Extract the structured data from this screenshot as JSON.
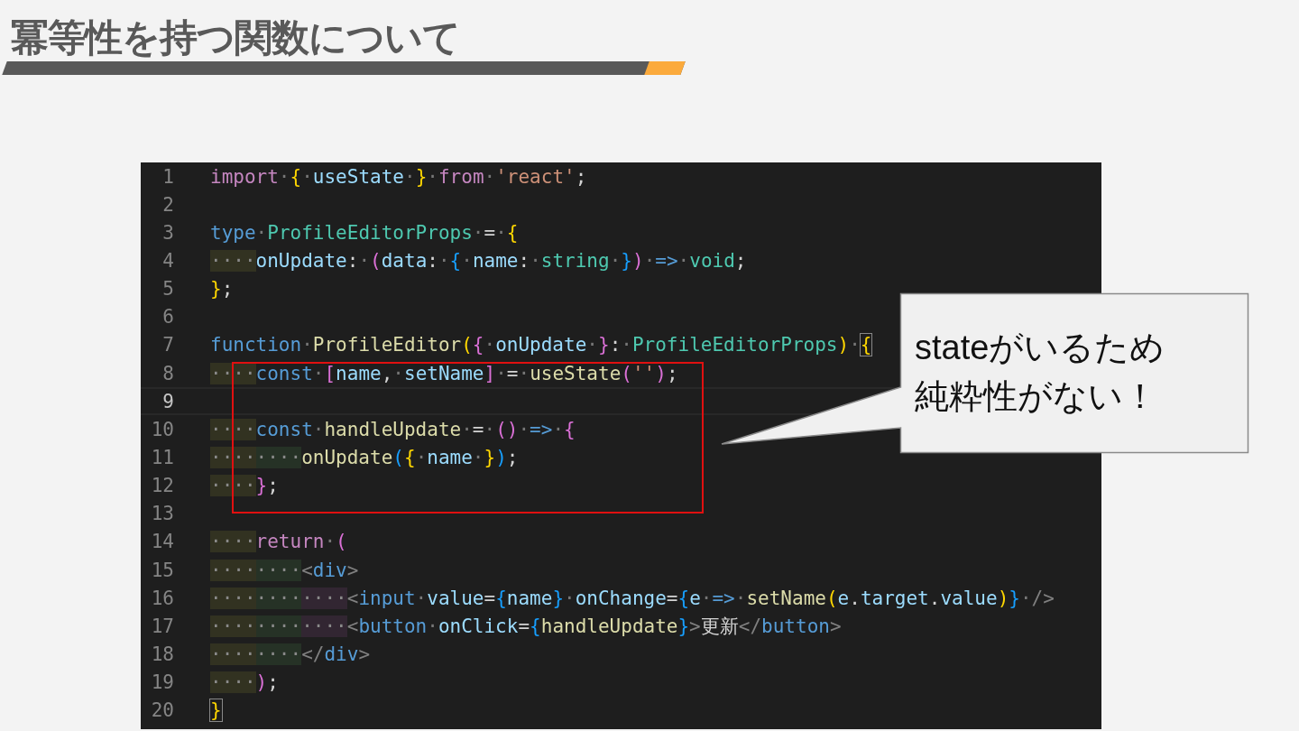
{
  "slide": {
    "title": "冪等性を持つ関数について"
  },
  "editor": {
    "lines": [
      {
        "n": "1",
        "current": false,
        "t": [
          {
            "s": "import",
            "kind": "kw"
          },
          {
            "s": "·",
            "kind": "ws"
          },
          {
            "s": "{",
            "kind": "b1"
          },
          {
            "s": "·",
            "kind": "ws"
          },
          {
            "s": "useState",
            "kind": "var"
          },
          {
            "s": "·",
            "kind": "ws"
          },
          {
            "s": "}",
            "kind": "b1"
          },
          {
            "s": "·",
            "kind": "ws"
          },
          {
            "s": "from",
            "kind": "kw"
          },
          {
            "s": "·",
            "kind": "ws"
          },
          {
            "s": "'react'",
            "kind": "str"
          },
          {
            "s": ";",
            "kind": "p"
          }
        ]
      },
      {
        "n": "2",
        "current": false
      },
      {
        "n": "3",
        "current": false,
        "t": [
          {
            "s": "type",
            "kind": "st"
          },
          {
            "s": "·",
            "kind": "ws"
          },
          {
            "s": "ProfileEditorProps",
            "kind": "ty"
          },
          {
            "s": "·",
            "kind": "ws"
          },
          {
            "s": "=",
            "kind": "p"
          },
          {
            "s": "·",
            "kind": "ws"
          },
          {
            "s": "{",
            "kind": "b1"
          }
        ]
      },
      {
        "n": "4",
        "current": false,
        "t": [
          {
            "s": "····",
            "kind": "ind"
          },
          {
            "s": "onUpdate",
            "kind": "var"
          },
          {
            "s": ":",
            "kind": "p"
          },
          {
            "s": "·",
            "kind": "ws"
          },
          {
            "s": "(",
            "kind": "b2"
          },
          {
            "s": "data",
            "kind": "var"
          },
          {
            "s": ":",
            "kind": "p"
          },
          {
            "s": "·",
            "kind": "ws"
          },
          {
            "s": "{",
            "kind": "b3"
          },
          {
            "s": "·",
            "kind": "ws"
          },
          {
            "s": "name",
            "kind": "var"
          },
          {
            "s": ":",
            "kind": "p"
          },
          {
            "s": "·",
            "kind": "ws"
          },
          {
            "s": "string",
            "kind": "ty"
          },
          {
            "s": "·",
            "kind": "ws"
          },
          {
            "s": "}",
            "kind": "b3"
          },
          {
            "s": ")",
            "kind": "b2"
          },
          {
            "s": "·",
            "kind": "ws"
          },
          {
            "s": "=>",
            "kind": "st"
          },
          {
            "s": "·",
            "kind": "ws"
          },
          {
            "s": "void",
            "kind": "ty"
          },
          {
            "s": ";",
            "kind": "p"
          }
        ]
      },
      {
        "n": "5",
        "current": false,
        "t": [
          {
            "s": "}",
            "kind": "b1"
          },
          {
            "s": ";",
            "kind": "p"
          }
        ]
      },
      {
        "n": "6",
        "current": false
      },
      {
        "n": "7",
        "current": false,
        "t": [
          {
            "s": "function",
            "kind": "st"
          },
          {
            "s": "·",
            "kind": "ws"
          },
          {
            "s": "ProfileEditor",
            "kind": "fn"
          },
          {
            "s": "(",
            "kind": "b1"
          },
          {
            "s": "{",
            "kind": "b2"
          },
          {
            "s": "·",
            "kind": "ws"
          },
          {
            "s": "onUpdate",
            "kind": "var"
          },
          {
            "s": "·",
            "kind": "ws"
          },
          {
            "s": "}",
            "kind": "b2"
          },
          {
            "s": ":",
            "kind": "p"
          },
          {
            "s": "·",
            "kind": "ws"
          },
          {
            "s": "ProfileEditorProps",
            "kind": "ty"
          },
          {
            "s": ")",
            "kind": "b1"
          },
          {
            "s": "·",
            "kind": "ws"
          },
          {
            "s": "{",
            "kind": "b1",
            "match": true
          }
        ]
      },
      {
        "n": "8",
        "current": false,
        "t": [
          {
            "s": "····",
            "kind": "ind"
          },
          {
            "s": "const",
            "kind": "st"
          },
          {
            "s": "·",
            "kind": "ws"
          },
          {
            "s": "[",
            "kind": "b2"
          },
          {
            "s": "name",
            "kind": "var"
          },
          {
            "s": ",",
            "kind": "p"
          },
          {
            "s": "·",
            "kind": "ws"
          },
          {
            "s": "setName",
            "kind": "var"
          },
          {
            "s": "]",
            "kind": "b2"
          },
          {
            "s": "·",
            "kind": "ws"
          },
          {
            "s": "=",
            "kind": "p"
          },
          {
            "s": "·",
            "kind": "ws"
          },
          {
            "s": "useState",
            "kind": "fn"
          },
          {
            "s": "(",
            "kind": "b2"
          },
          {
            "s": "''",
            "kind": "str"
          },
          {
            "s": ")",
            "kind": "b2"
          },
          {
            "s": ";",
            "kind": "p"
          }
        ]
      },
      {
        "n": "9",
        "current": true
      },
      {
        "n": "10",
        "current": false,
        "t": [
          {
            "s": "····",
            "kind": "ind"
          },
          {
            "s": "const",
            "kind": "st"
          },
          {
            "s": "·",
            "kind": "ws"
          },
          {
            "s": "handleUpdate",
            "kind": "fn"
          },
          {
            "s": "·",
            "kind": "ws"
          },
          {
            "s": "=",
            "kind": "p"
          },
          {
            "s": "·",
            "kind": "ws"
          },
          {
            "s": "(",
            "kind": "b2"
          },
          {
            "s": ")",
            "kind": "b2"
          },
          {
            "s": "·",
            "kind": "ws"
          },
          {
            "s": "=>",
            "kind": "st"
          },
          {
            "s": "·",
            "kind": "ws"
          },
          {
            "s": "{",
            "kind": "b2"
          }
        ]
      },
      {
        "n": "11",
        "current": false,
        "t": [
          {
            "s": "········",
            "kind": "ind"
          },
          {
            "s": "onUpdate",
            "kind": "fn"
          },
          {
            "s": "(",
            "kind": "b3"
          },
          {
            "s": "{",
            "kind": "b1"
          },
          {
            "s": "·",
            "kind": "ws"
          },
          {
            "s": "name",
            "kind": "var"
          },
          {
            "s": "·",
            "kind": "ws"
          },
          {
            "s": "}",
            "kind": "b1"
          },
          {
            "s": ")",
            "kind": "b3"
          },
          {
            "s": ";",
            "kind": "p"
          }
        ]
      },
      {
        "n": "12",
        "current": false,
        "t": [
          {
            "s": "····",
            "kind": "ind"
          },
          {
            "s": "}",
            "kind": "b2"
          },
          {
            "s": ";",
            "kind": "p"
          }
        ]
      },
      {
        "n": "13",
        "current": false
      },
      {
        "n": "14",
        "current": false,
        "t": [
          {
            "s": "····",
            "kind": "ind"
          },
          {
            "s": "return",
            "kind": "kw"
          },
          {
            "s": "·",
            "kind": "ws"
          },
          {
            "s": "(",
            "kind": "b2"
          }
        ]
      },
      {
        "n": "15",
        "current": false,
        "t": [
          {
            "s": "········",
            "kind": "ind"
          },
          {
            "s": "<",
            "kind": "tg"
          },
          {
            "s": "div",
            "kind": "tn"
          },
          {
            "s": ">",
            "kind": "tg"
          }
        ]
      },
      {
        "n": "16",
        "current": false,
        "t": [
          {
            "s": "············",
            "kind": "ind"
          },
          {
            "s": "<",
            "kind": "tg"
          },
          {
            "s": "input",
            "kind": "tn"
          },
          {
            "s": "·",
            "kind": "ws"
          },
          {
            "s": "value",
            "kind": "at"
          },
          {
            "s": "=",
            "kind": "p"
          },
          {
            "s": "{",
            "kind": "b3"
          },
          {
            "s": "name",
            "kind": "var"
          },
          {
            "s": "}",
            "kind": "b3"
          },
          {
            "s": "·",
            "kind": "ws"
          },
          {
            "s": "onChange",
            "kind": "at"
          },
          {
            "s": "=",
            "kind": "p"
          },
          {
            "s": "{",
            "kind": "b3"
          },
          {
            "s": "e",
            "kind": "var"
          },
          {
            "s": "·",
            "kind": "ws"
          },
          {
            "s": "=>",
            "kind": "st"
          },
          {
            "s": "·",
            "kind": "ws"
          },
          {
            "s": "setName",
            "kind": "fn"
          },
          {
            "s": "(",
            "kind": "b1"
          },
          {
            "s": "e",
            "kind": "var"
          },
          {
            "s": ".",
            "kind": "p"
          },
          {
            "s": "target",
            "kind": "var"
          },
          {
            "s": ".",
            "kind": "p"
          },
          {
            "s": "value",
            "kind": "var"
          },
          {
            "s": ")",
            "kind": "b1"
          },
          {
            "s": "}",
            "kind": "b3"
          },
          {
            "s": "·",
            "kind": "ws"
          },
          {
            "s": "/>",
            "kind": "tg"
          }
        ]
      },
      {
        "n": "17",
        "current": false,
        "t": [
          {
            "s": "············",
            "kind": "ind"
          },
          {
            "s": "<",
            "kind": "tg"
          },
          {
            "s": "button",
            "kind": "tn"
          },
          {
            "s": "·",
            "kind": "ws"
          },
          {
            "s": "onClick",
            "kind": "at"
          },
          {
            "s": "=",
            "kind": "p"
          },
          {
            "s": "{",
            "kind": "b3"
          },
          {
            "s": "handleUpdate",
            "kind": "fn"
          },
          {
            "s": "}",
            "kind": "b3"
          },
          {
            "s": ">",
            "kind": "tg"
          },
          {
            "s": "更新",
            "kind": "p"
          },
          {
            "s": "</",
            "kind": "tg"
          },
          {
            "s": "button",
            "kind": "tn"
          },
          {
            "s": ">",
            "kind": "tg"
          }
        ]
      },
      {
        "n": "18",
        "current": false,
        "t": [
          {
            "s": "········",
            "kind": "ind"
          },
          {
            "s": "</",
            "kind": "tg"
          },
          {
            "s": "div",
            "kind": "tn"
          },
          {
            "s": ">",
            "kind": "tg"
          }
        ]
      },
      {
        "n": "19",
        "current": false,
        "t": [
          {
            "s": "····",
            "kind": "ind"
          },
          {
            "s": ")",
            "kind": "b2"
          },
          {
            "s": ";",
            "kind": "p"
          }
        ]
      },
      {
        "n": "20",
        "current": false,
        "t": [
          {
            "s": "}",
            "kind": "b1",
            "match": true
          }
        ]
      }
    ]
  },
  "callout": {
    "lines": [
      "stateがいるため",
      "純粋性がない！"
    ]
  }
}
